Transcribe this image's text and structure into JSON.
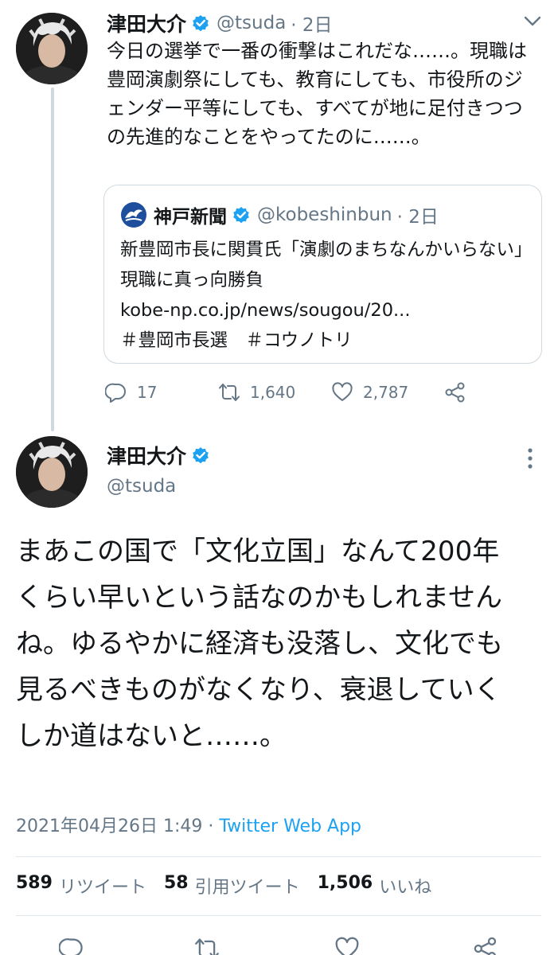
{
  "tweet1": {
    "name": "津田大介",
    "handle": "@tsuda",
    "time": "· 2日",
    "text": "今日の選挙で一番の衝撃はこれだな……。現職は豊岡演劇祭にしても、教育にしても、市役所のジェンダー平等にしても、すべてが地に足付きつつの先進的なことをやってたのに……。",
    "quote": {
      "name": "神戸新聞",
      "handle": "@kobeshinbun",
      "time": "· 2日",
      "line1": "新豊岡市長に関貫氏「演劇のまちなんかいらない」　現職に真っ向勝負",
      "link": "kobe-np.co.jp/news/sougou/20...",
      "tags": "＃豊岡市長選　＃コウノトリ"
    },
    "actions": {
      "replies": "17",
      "retweets": "1,640",
      "likes": "2,787"
    }
  },
  "tweet2": {
    "name": "津田大介",
    "handle": "@tsuda",
    "text": "まあこの国で「文化立国」なんて200年くらい早いという話なのかもしれませんね。ゆるやかに経済も没落し、文化でも見るべきものがなくなり、衰退していくしか道はないと……。",
    "timestamp": "2021年04月26日 1:49 · ",
    "source": "Twitter Web App",
    "stats": {
      "retweets_count": "589",
      "retweets_label": "リツイート",
      "quotes_count": "58",
      "quotes_label": "引用ツイート",
      "likes_count": "1,506",
      "likes_label": "いいね"
    }
  },
  "colors": {
    "verified": "#1da1f2",
    "secondary_text": "#657786",
    "link": "#1da1f2",
    "border": "#cfd9de"
  },
  "icons": [
    "verified-badge-icon",
    "chevron-down-icon",
    "reply-icon",
    "retweet-icon",
    "like-icon",
    "share-icon",
    "more-vertical-icon",
    "kobe-shinbun-logo-icon"
  ]
}
